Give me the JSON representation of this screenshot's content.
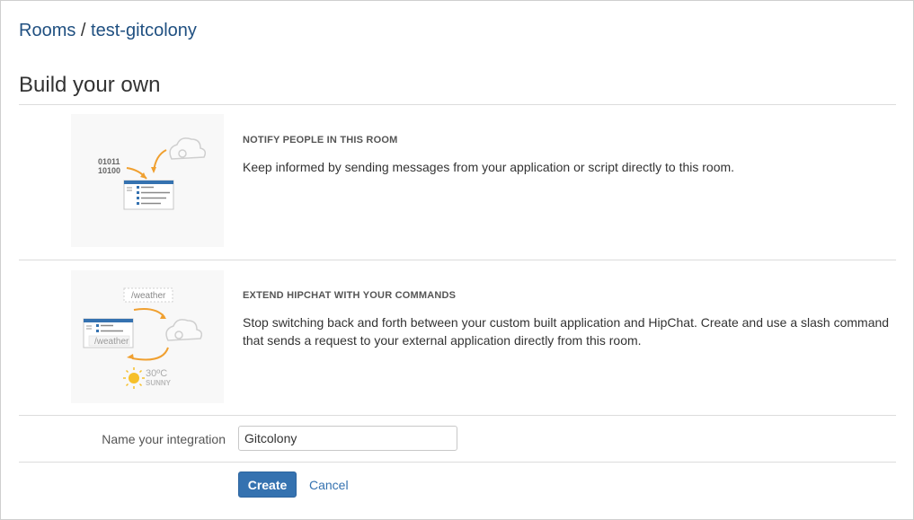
{
  "breadcrumb": {
    "rooms": "Rooms",
    "separator": "/",
    "room": "test-gitcolony"
  },
  "page": {
    "title": "Build your own"
  },
  "sections": [
    {
      "title": "NOTIFY PEOPLE IN THIS ROOM",
      "description": "Keep informed by sending messages from your application or script directly to this room.",
      "illustration": {
        "binary_line1": "01011",
        "binary_line2": "10100",
        "icons": [
          "cloud-gear-icon",
          "arrow-icon",
          "chat-window-icon"
        ]
      }
    },
    {
      "title": "EXTEND HIPCHAT WITH YOUR COMMANDS",
      "description": "Stop switching back and forth between your custom built application and HipChat. Create and use a slash command that sends a request to your external application directly from this room.",
      "illustration": {
        "command_top": "/weather",
        "command_window": "/weather",
        "temperature": "30ºC",
        "condition": "SUNNY",
        "icons": [
          "cloud-gear-icon",
          "arrow-icon",
          "chat-window-icon",
          "sun-icon"
        ]
      }
    }
  ],
  "form": {
    "name_label": "Name your integration",
    "name_value": "Gitcolony",
    "create_label": "Create",
    "cancel_label": "Cancel"
  },
  "colors": {
    "link": "#205081",
    "primary_button": "#3572b0",
    "accent_orange": "#f0a030",
    "sun": "#f6c02a"
  }
}
